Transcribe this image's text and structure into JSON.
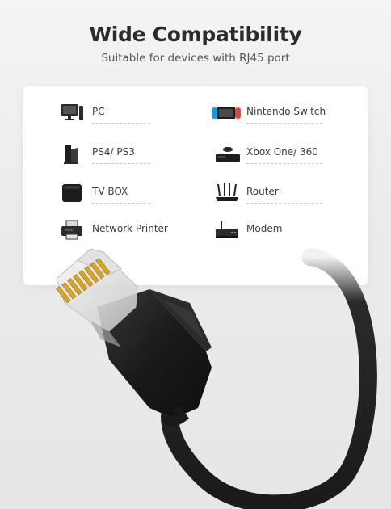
{
  "heading": {
    "title": "Wide Compatibility",
    "subtitle": "Suitable for devices with RJ45 port"
  },
  "devices": {
    "left": [
      {
        "label": "PC",
        "icon": "desktop-pc-icon"
      },
      {
        "label": "PS4/ PS3",
        "icon": "game-console-icon"
      },
      {
        "label": "TV BOX",
        "icon": "tv-box-icon"
      },
      {
        "label": "Network Printer",
        "icon": "printer-icon"
      }
    ],
    "right": [
      {
        "label": "Nintendo Switch",
        "icon": "nintendo-switch-icon"
      },
      {
        "label": "Xbox One/ 360",
        "icon": "xbox-console-icon"
      },
      {
        "label": "Router",
        "icon": "router-icon"
      },
      {
        "label": "Modem",
        "icon": "modem-icon"
      }
    ]
  },
  "colors": {
    "title": "#2b2b2b",
    "cable": "#1f1f1f",
    "contacts": "#d9a526"
  }
}
